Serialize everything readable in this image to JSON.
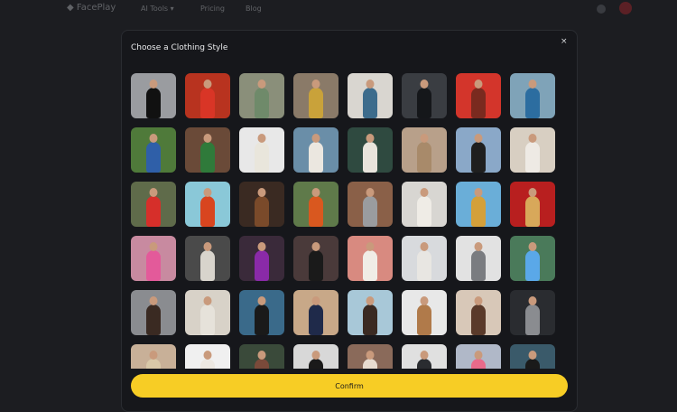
{
  "topbar": {
    "logo": "◆ FacePlay",
    "nav": [
      "AI Tools ▾",
      "Pricing",
      "Blog"
    ],
    "icons": [
      "grid-icon",
      "avatar"
    ]
  },
  "modal": {
    "title": "Choose a Clothing Style",
    "close_icon": "×",
    "confirm_label": "Confirm"
  },
  "styles": [
    {
      "bg": "#9a9ca0",
      "outfit": "#111111"
    },
    {
      "bg": "#b8331f",
      "outfit": "#d93526"
    },
    {
      "bg": "#8a8f7a",
      "outfit": "#6f8a6a"
    },
    {
      "bg": "#8a7a68",
      "outfit": "#c9a23a"
    },
    {
      "bg": "#d9d6d0",
      "outfit": "#3d6c8c"
    },
    {
      "bg": "#3a3d42",
      "outfit": "#15171a"
    },
    {
      "bg": "#d3352b",
      "outfit": "#7a2a1f"
    },
    {
      "bg": "#7fa3b8",
      "outfit": "#2c6da0"
    },
    {
      "bg": "#4f7a3a",
      "outfit": "#2f5fa8"
    },
    {
      "bg": "#6a4a38",
      "outfit": "#2f7a3a"
    },
    {
      "bg": "#e8e8e8",
      "outfit": "#e9e6dc"
    },
    {
      "bg": "#6a8ea8",
      "outfit": "#ebe7e0"
    },
    {
      "bg": "#2f4a40",
      "outfit": "#e8e4dc"
    },
    {
      "bg": "#b8a08a",
      "outfit": "#a88a6a"
    },
    {
      "bg": "#8aa8c8",
      "outfit": "#1f1f1f"
    },
    {
      "bg": "#d8cfc2",
      "outfit": "#eeeae4"
    },
    {
      "bg": "#5f6b4a",
      "outfit": "#d62f2a"
    },
    {
      "bg": "#8ac8d8",
      "outfit": "#d8451f"
    },
    {
      "bg": "#3a2a22",
      "outfit": "#7a4a2a"
    },
    {
      "bg": "#5f7a4a",
      "outfit": "#d9581f"
    },
    {
      "bg": "#8a6048",
      "outfit": "#9a9c9f"
    },
    {
      "bg": "#d8d6d2",
      "outfit": "#efece6"
    },
    {
      "bg": "#6aaed8",
      "outfit": "#d4a03a"
    },
    {
      "bg": "#b81f1f",
      "outfit": "#d8a85a"
    },
    {
      "bg": "#c88aa0",
      "outfit": "#e35a9a"
    },
    {
      "bg": "#4a4a4a",
      "outfit": "#d8d4cc"
    },
    {
      "bg": "#3a2a3a",
      "outfit": "#8a2aa8"
    },
    {
      "bg": "#4a3a3a",
      "outfit": "#1a1a1a"
    },
    {
      "bg": "#d88a80",
      "outfit": "#f0ece6"
    },
    {
      "bg": "#d8dadd",
      "outfit": "#e8e6e2"
    },
    {
      "bg": "#e2e2e2",
      "outfit": "#7a7c80"
    },
    {
      "bg": "#4a7a5a",
      "outfit": "#5aa8e8"
    },
    {
      "bg": "#8a8c90",
      "outfit": "#3a2a22"
    },
    {
      "bg": "#d8d2c8",
      "outfit": "#e6e2da"
    },
    {
      "bg": "#3a6a8a",
      "outfit": "#1a1a1a"
    },
    {
      "bg": "#c8a888",
      "outfit": "#1f2a4a"
    },
    {
      "bg": "#a8c8d8",
      "outfit": "#3a2a22"
    },
    {
      "bg": "#e8e8e8",
      "outfit": "#b07a4a"
    },
    {
      "bg": "#d8c8b8",
      "outfit": "#5a3a2a"
    },
    {
      "bg": "#2a2c30",
      "outfit": "#8a8c90"
    },
    {
      "bg": "#c8b098",
      "outfit": "#d8c8a8"
    },
    {
      "bg": "#f0f0f0",
      "outfit": "#ece8e2"
    },
    {
      "bg": "#3a4a3a",
      "outfit": "#7a4a3a"
    },
    {
      "bg": "#d8d8d8",
      "outfit": "#1a1a1a"
    },
    {
      "bg": "#8a6a5a",
      "outfit": "#e8dcd0"
    },
    {
      "bg": "#e0e0e0",
      "outfit": "#2a2c30"
    },
    {
      "bg": "#b0b8c8",
      "outfit": "#e86a8a"
    },
    {
      "bg": "#3a5a6a",
      "outfit": "#1a1a1a"
    }
  ]
}
